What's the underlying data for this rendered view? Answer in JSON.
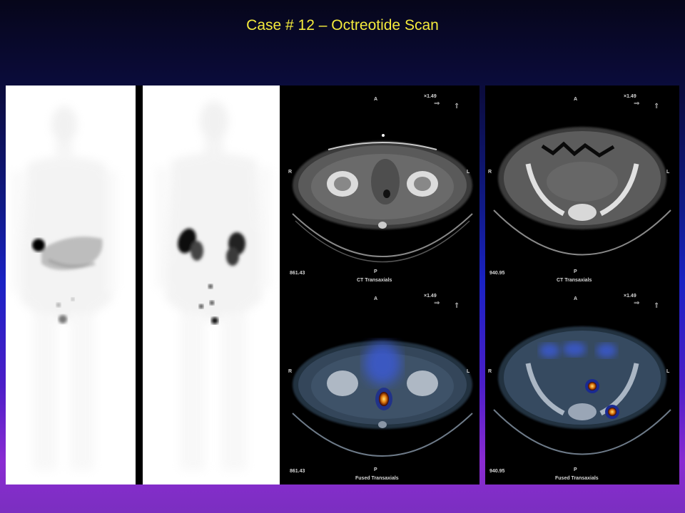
{
  "title": "Case # 12 – Octreotide Scan",
  "ct_panels": [
    {
      "top": {
        "ant": "A",
        "post": "P",
        "right": "R",
        "left": "L",
        "zoom": "×1.49",
        "value": "861.43",
        "caption": "CT Transaxials"
      },
      "bottom": {
        "ant": "A",
        "post": "P",
        "right": "R",
        "left": "L",
        "zoom": "×1.49",
        "value": "861.43",
        "caption": "Fused Transaxials"
      }
    },
    {
      "top": {
        "ant": "A",
        "post": "P",
        "right": "R",
        "left": "L",
        "zoom": "×1.49",
        "value": "940.95",
        "caption": "CT Transaxials"
      },
      "bottom": {
        "ant": "A",
        "post": "P",
        "right": "R",
        "left": "L",
        "zoom": "×1.49",
        "value": "940.95",
        "caption": "Fused Transaxials"
      }
    }
  ],
  "icons": [
    "arrow-right-icon",
    "arrow-up-icon"
  ]
}
